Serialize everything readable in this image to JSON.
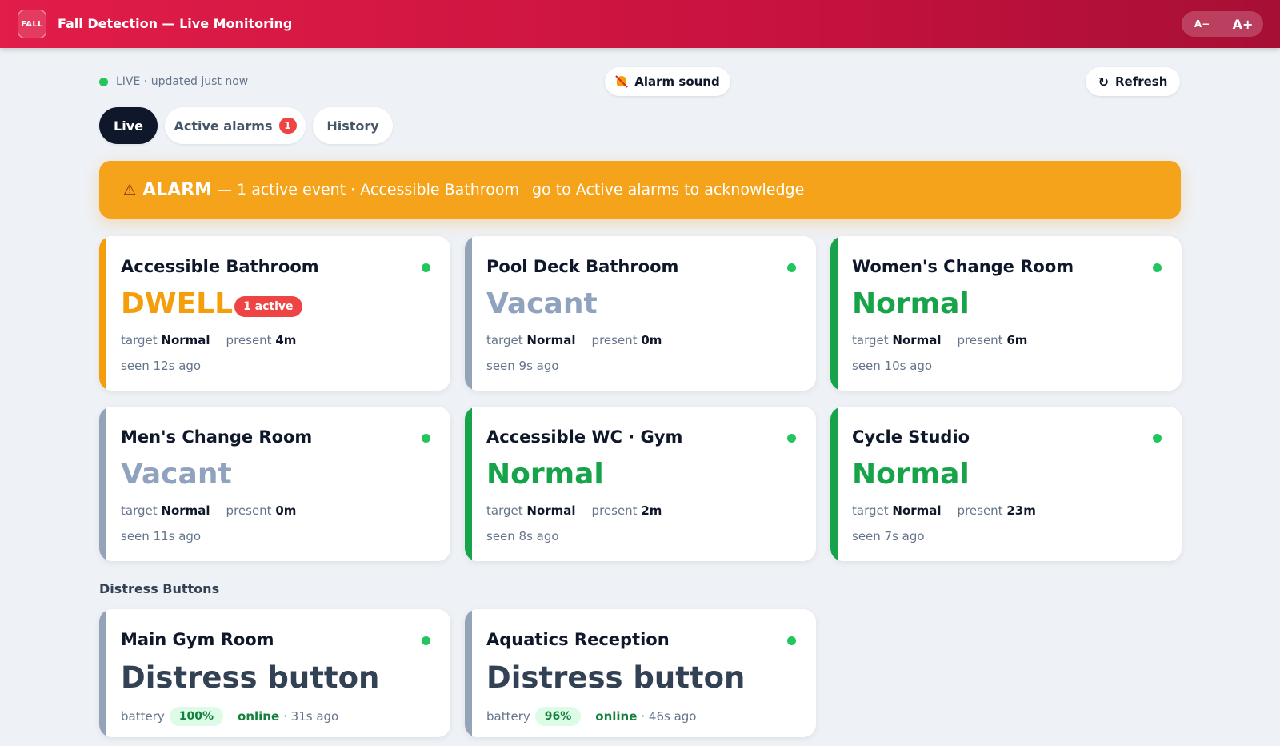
{
  "header": {
    "logo_text": "FALL",
    "title": "Fall Detection — Live Monitoring",
    "zoom_out_label": "A−",
    "zoom_in_label": "A+"
  },
  "status": {
    "text": "LIVE · updated just now"
  },
  "toolbar": {
    "alarm_sound_label": "Alarm sound",
    "refresh_label": "Refresh"
  },
  "tabs": [
    {
      "label": "Live",
      "active": true
    },
    {
      "label": "Active alarms",
      "badge": "1"
    },
    {
      "label": "History"
    }
  ],
  "banner": {
    "icon": "warning-icon",
    "word": "ALARM",
    "detail": "— 1 active event · Accessible Bathroom",
    "action": "go to Active alarms to acknowledge"
  },
  "rooms": [
    {
      "name": "Accessible Bathroom",
      "state": "DWELL",
      "state_color": "#f59e0b",
      "badge": "1 active",
      "target_label": "target",
      "target": "Normal",
      "present_label": "present",
      "present": "4m",
      "seen": "seen 12s ago"
    },
    {
      "name": "Pool Deck Bathroom",
      "state": "Vacant",
      "state_color": "#8fa3bf",
      "target_label": "target",
      "target": "Normal",
      "present_label": "present",
      "present": "0m",
      "seen": "seen 9s ago"
    },
    {
      "name": "Women's Change Room",
      "state": "Normal",
      "state_color": "#16a34a",
      "target_label": "target",
      "target": "Normal",
      "present_label": "present",
      "present": "6m",
      "seen": "seen 10s ago"
    },
    {
      "name": "Men's Change Room",
      "state": "Vacant",
      "state_color": "#8fa3bf",
      "target_label": "target",
      "target": "Normal",
      "present_label": "present",
      "present": "0m",
      "seen": "seen 11s ago"
    },
    {
      "name": "Accessible WC · Gym",
      "state": "Normal",
      "state_color": "#16a34a",
      "target_label": "target",
      "target": "Normal",
      "present_label": "present",
      "present": "2m",
      "seen": "seen 8s ago"
    },
    {
      "name": "Cycle Studio",
      "state": "Normal",
      "state_color": "#16a34a",
      "target_label": "target",
      "target": "Normal",
      "present_label": "present",
      "present": "23m",
      "seen": "seen 7s ago"
    }
  ],
  "distress": {
    "title": "Distress Buttons",
    "items": [
      {
        "name": "Main Gym Room",
        "state": "Distress button",
        "battery_label": "battery",
        "battery": "100%",
        "online": "online",
        "seen": "· 31s ago"
      },
      {
        "name": "Aquatics Reception",
        "state": "Distress button",
        "battery_label": "battery",
        "battery": "96%",
        "online": "online",
        "seen": "· 46s ago"
      }
    ]
  },
  "colors": {
    "header_start": "#e11d48",
    "header_end": "#a70f35",
    "alarm": "#f5a31b",
    "stripe_alarm": "#f59e0b",
    "stripe_vacant": "#94a3b8",
    "stripe_normal": "#16a34a",
    "online_dot": "#22c55e"
  }
}
